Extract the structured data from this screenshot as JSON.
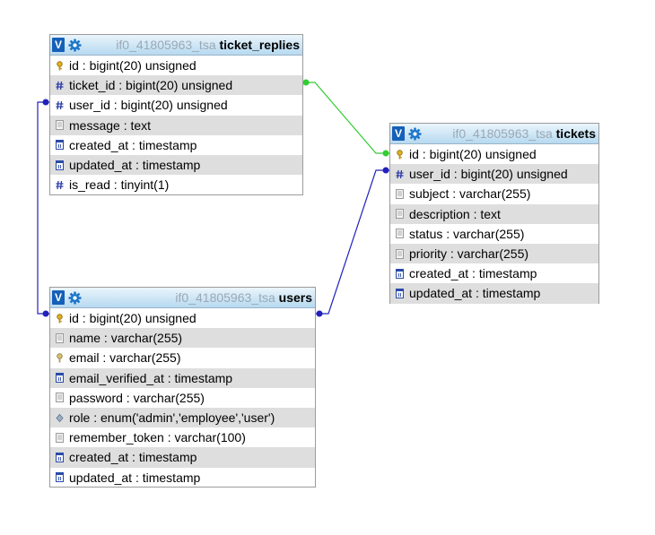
{
  "colors": {
    "header_top": "#eaf5fc",
    "header_bottom": "#b6d9f0",
    "toggle_bg": "#1560b8",
    "alt_row": "#dedede",
    "relation_green": "#33cc33",
    "relation_blue": "#2222bb"
  },
  "tables": [
    {
      "id": "ticket_replies",
      "toggle": "V",
      "db": "if0_41805963_tsa",
      "name": "ticket_replies",
      "columns": [
        {
          "text": "id : bigint(20) unsigned",
          "icon": "primary-key-icon"
        },
        {
          "text": "ticket_id : bigint(20) unsigned",
          "icon": "hash-icon"
        },
        {
          "text": "user_id : bigint(20) unsigned",
          "icon": "hash-icon"
        },
        {
          "text": "message : text",
          "icon": "text-type-icon"
        },
        {
          "text": "created_at : timestamp",
          "icon": "timestamp-icon"
        },
        {
          "text": "updated_at : timestamp",
          "icon": "timestamp-icon"
        },
        {
          "text": "is_read : tinyint(1)",
          "icon": "hash-icon"
        }
      ]
    },
    {
      "id": "tickets",
      "toggle": "V",
      "db": "if0_41805963_tsa",
      "name": "tickets",
      "columns": [
        {
          "text": "id : bigint(20) unsigned",
          "icon": "primary-key-icon"
        },
        {
          "text": "user_id : bigint(20) unsigned",
          "icon": "hash-icon"
        },
        {
          "text": "subject : varchar(255)",
          "icon": "text-type-icon"
        },
        {
          "text": "description : text",
          "icon": "text-type-icon"
        },
        {
          "text": "status : varchar(255)",
          "icon": "text-type-icon"
        },
        {
          "text": "priority : varchar(255)",
          "icon": "text-type-icon"
        },
        {
          "text": "created_at : timestamp",
          "icon": "timestamp-icon"
        },
        {
          "text": "updated_at : timestamp",
          "icon": "timestamp-icon"
        }
      ]
    },
    {
      "id": "users",
      "toggle": "V",
      "db": "if0_41805963_tsa",
      "name": "users",
      "columns": [
        {
          "text": "id : bigint(20) unsigned",
          "icon": "primary-key-icon"
        },
        {
          "text": "name : varchar(255)",
          "icon": "text-type-icon"
        },
        {
          "text": "email : varchar(255)",
          "icon": "unique-key-icon"
        },
        {
          "text": "email_verified_at : timestamp",
          "icon": "timestamp-icon"
        },
        {
          "text": "password : varchar(255)",
          "icon": "text-type-icon"
        },
        {
          "text": "role : enum('admin','employee','user')",
          "icon": "enum-icon"
        },
        {
          "text": "remember_token : varchar(100)",
          "icon": "text-type-icon"
        },
        {
          "text": "created_at : timestamp",
          "icon": "timestamp-icon"
        },
        {
          "text": "updated_at : timestamp",
          "icon": "timestamp-icon"
        }
      ]
    }
  ]
}
